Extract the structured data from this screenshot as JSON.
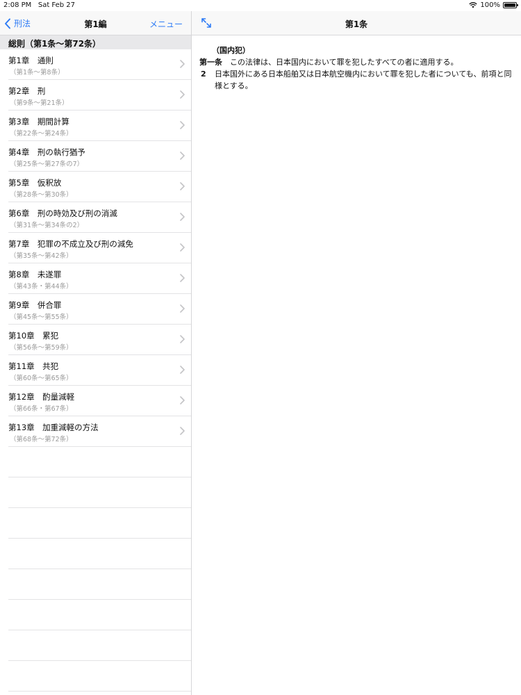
{
  "status": {
    "time": "2:08 PM",
    "date": "Sat Feb 27",
    "battery": "100%",
    "battery_level": 1.0
  },
  "master": {
    "back_label": "刑法",
    "title": "第1編",
    "menu_label": "メニュー",
    "section_header": "総則（第1条～第72条）",
    "chapters": [
      {
        "title": "第1章　通則",
        "range": "（第1条～第8条）"
      },
      {
        "title": "第2章　刑",
        "range": "（第9条～第21条）"
      },
      {
        "title": "第3章　期間計算",
        "range": "（第22条～第24条）"
      },
      {
        "title": "第4章　刑の執行猶予",
        "range": "（第25条～第27条の7）"
      },
      {
        "title": "第5章　仮釈放",
        "range": "（第28条～第30条）"
      },
      {
        "title": "第6章　刑の時効及び刑の消滅",
        "range": "（第31条～第34条の2）"
      },
      {
        "title": "第7章　犯罪の不成立及び刑の減免",
        "range": "（第35条～第42条）"
      },
      {
        "title": "第8章　未遂罪",
        "range": "（第43条・第44条）"
      },
      {
        "title": "第9章　併合罪",
        "range": "（第45条～第55条）"
      },
      {
        "title": "第10章　累犯",
        "range": "（第56条～第59条）"
      },
      {
        "title": "第11章　共犯",
        "range": "（第60条～第65条）"
      },
      {
        "title": "第12章　酌量減軽",
        "range": "（第66条・第67条）"
      },
      {
        "title": "第13章　加重減軽の方法",
        "range": "（第68条～第72条）"
      }
    ]
  },
  "detail": {
    "title": "第1条",
    "heading": "（国内犯）",
    "para1_label": "第一条",
    "para1_text": "　この法律は、日本国内において罪を犯したすべての者に適用する。",
    "para2_num": "2",
    "para2_text": "日本国外にある日本船舶又は日本航空機内において罪を犯した者についても、前項と同様とする。"
  },
  "colors": {
    "accent": "#2f7cf6",
    "subtext": "#9a9a9a",
    "section_bg": "#e8e8ea"
  }
}
